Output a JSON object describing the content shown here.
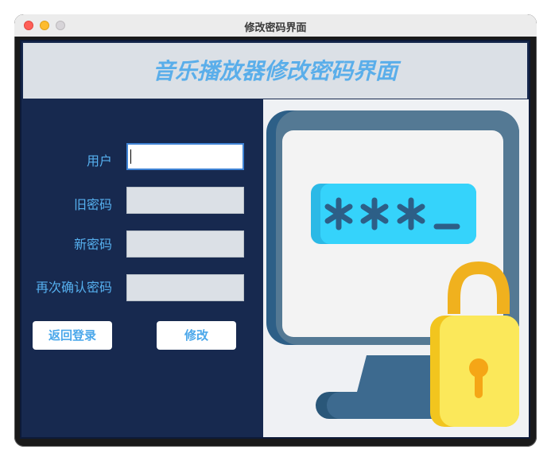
{
  "window": {
    "title": "修改密码界面"
  },
  "header": {
    "title": "音乐播放器修改密码界面"
  },
  "form": {
    "user_label": "用户",
    "old_password_label": "旧密码",
    "new_password_label": "新密码",
    "confirm_password_label": "再次确认密码",
    "user_value": "",
    "old_password_value": "",
    "new_password_value": "",
    "confirm_password_value": ""
  },
  "buttons": {
    "back_label": "返回登录",
    "modify_label": "修改"
  },
  "illustration": {
    "password_text": "***_",
    "icons": [
      "monitor-icon",
      "padlock-icon"
    ]
  },
  "colors": {
    "panel": "#17294f",
    "label": "#56b0ef",
    "header_bg": "#dbe0e6",
    "accent": "#3f83d5"
  }
}
